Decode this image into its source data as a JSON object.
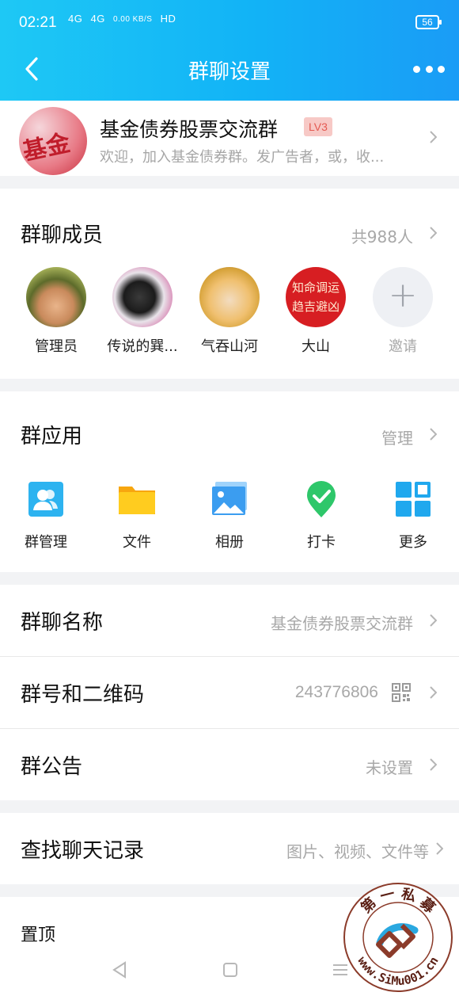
{
  "status_bar": {
    "time": "02:21",
    "signal1": "4G",
    "signal2": "4G",
    "speed": "0.00 KB/S",
    "hd": "HD",
    "battery": "56"
  },
  "nav": {
    "title": "群聊设置",
    "back_icon": "chevron-left-icon",
    "more_icon": "more-dots-icon"
  },
  "group": {
    "avatar_text": "基金",
    "name": "基金债券股票交流群",
    "level": "LV3",
    "description": "欢迎，加入基金债券群。发广告者，或，收..."
  },
  "members": {
    "title": "群聊成员",
    "count": "共988人",
    "list": [
      {
        "name": "管理员"
      },
      {
        "name": "传说的巽..."
      },
      {
        "name": "气吞山河"
      },
      {
        "name": "大山",
        "avatar_text": "知命调运\n趋吉避凶"
      },
      {
        "name": "邀请",
        "avatar_text": "+"
      }
    ]
  },
  "apps": {
    "title": "群应用",
    "manage": "管理",
    "items": [
      {
        "label": "群管理",
        "icon": "group-manage-icon",
        "color": "#2db3f0"
      },
      {
        "label": "文件",
        "icon": "folder-icon",
        "color": "#ffc21a"
      },
      {
        "label": "相册",
        "icon": "photo-album-icon",
        "color": "#3b9df0"
      },
      {
        "label": "打卡",
        "icon": "check-in-icon",
        "color": "#2ec76a"
      },
      {
        "label": "更多",
        "icon": "grid-more-icon",
        "color": "#20a8ee"
      }
    ]
  },
  "info_rows": [
    {
      "title": "群聊名称",
      "value": "基金债券股票交流群"
    },
    {
      "title": "群号和二维码",
      "value": "243776806",
      "icon": "qr-code-icon"
    },
    {
      "title": "群公告",
      "value": "未设置"
    }
  ],
  "search_row": {
    "title": "查找聊天记录",
    "value": "图片、视频、文件等"
  },
  "pin_row": {
    "title": "置顶"
  },
  "watermark": {
    "top_text": "第 一 私 募",
    "url": "www.SiMu001.cn"
  },
  "colors": {
    "header_start": "#1ec8f5",
    "header_end": "#1a9cf6",
    "muted": "#a8a8a8",
    "level_bg": "#f7c9c6",
    "level_text": "#e45a52"
  }
}
